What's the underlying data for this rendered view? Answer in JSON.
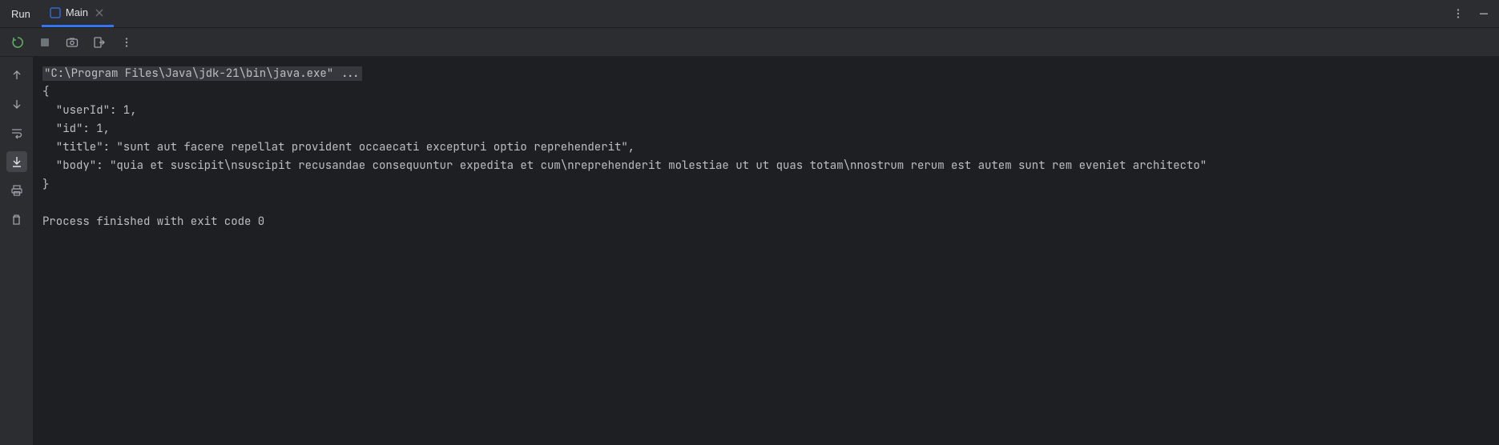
{
  "header": {
    "title": "Run",
    "tab_label": "Main"
  },
  "console": {
    "command": "\"C:\\Program Files\\Java\\jdk-21\\bin\\java.exe\" ...",
    "line_open": "{",
    "line_userId": "  \"userId\": 1,",
    "line_id": "  \"id\": 1,",
    "line_title": "  \"title\": \"sunt aut facere repellat provident occaecati excepturi optio reprehenderit\",",
    "line_body": "  \"body\": \"quia et suscipit\\nsuscipit recusandae consequuntur expedita et cum\\nreprehenderit molestiae ut ut quas totam\\nnostrum rerum est autem sunt rem eveniet architecto\"",
    "line_close": "}",
    "exit_msg": "Process finished with exit code 0"
  }
}
